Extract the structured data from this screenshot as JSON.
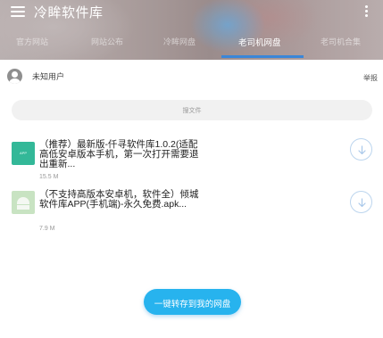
{
  "header": {
    "title": "冷眸软件库",
    "tabs": [
      {
        "label": "官方网站"
      },
      {
        "label": "网站公布"
      },
      {
        "label": "冷眸网盘"
      },
      {
        "label": "老司机网盘"
      },
      {
        "label": "老司机合集"
      }
    ],
    "active_tab_index": 3,
    "accent_color": "#3a86d8"
  },
  "user": {
    "name": "未知用户",
    "report_label": "举报"
  },
  "search": {
    "placeholder": "搜文件"
  },
  "files": [
    {
      "icon": "apk-icon",
      "icon_label": "APP",
      "title": "（推荐）最新版-仟寻软件库1.0.2(适配高低安卓版本手机，第一次打开需要退出重新...",
      "size": "15.5 M"
    },
    {
      "icon": "android-icon",
      "title": "（不支持高版本安卓机，软件全）倾城软件库APP(手机端)-永久免费.apk...",
      "size": "7.9 M"
    }
  ],
  "action": {
    "save_label": "一键转存到我的网盘",
    "color": "#27b3ee"
  }
}
